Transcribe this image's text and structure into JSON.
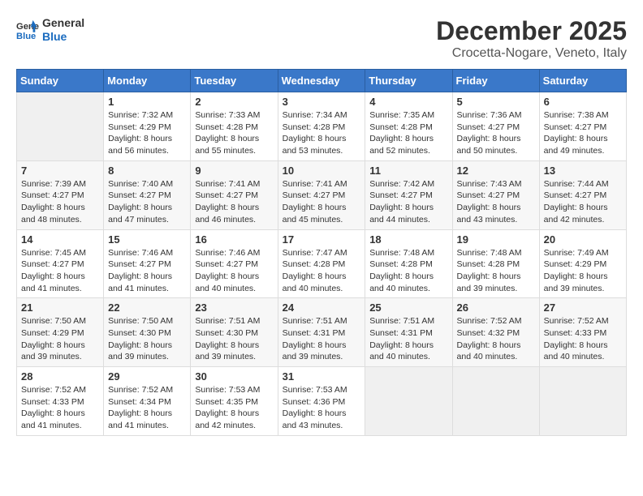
{
  "header": {
    "logo_line1": "General",
    "logo_line2": "Blue",
    "month": "December 2025",
    "location": "Crocetta-Nogare, Veneto, Italy"
  },
  "days_of_week": [
    "Sunday",
    "Monday",
    "Tuesday",
    "Wednesday",
    "Thursday",
    "Friday",
    "Saturday"
  ],
  "weeks": [
    [
      {
        "num": "",
        "info": ""
      },
      {
        "num": "1",
        "info": "Sunrise: 7:32 AM\nSunset: 4:29 PM\nDaylight: 8 hours\nand 56 minutes."
      },
      {
        "num": "2",
        "info": "Sunrise: 7:33 AM\nSunset: 4:28 PM\nDaylight: 8 hours\nand 55 minutes."
      },
      {
        "num": "3",
        "info": "Sunrise: 7:34 AM\nSunset: 4:28 PM\nDaylight: 8 hours\nand 53 minutes."
      },
      {
        "num": "4",
        "info": "Sunrise: 7:35 AM\nSunset: 4:28 PM\nDaylight: 8 hours\nand 52 minutes."
      },
      {
        "num": "5",
        "info": "Sunrise: 7:36 AM\nSunset: 4:27 PM\nDaylight: 8 hours\nand 50 minutes."
      },
      {
        "num": "6",
        "info": "Sunrise: 7:38 AM\nSunset: 4:27 PM\nDaylight: 8 hours\nand 49 minutes."
      }
    ],
    [
      {
        "num": "7",
        "info": "Sunrise: 7:39 AM\nSunset: 4:27 PM\nDaylight: 8 hours\nand 48 minutes."
      },
      {
        "num": "8",
        "info": "Sunrise: 7:40 AM\nSunset: 4:27 PM\nDaylight: 8 hours\nand 47 minutes."
      },
      {
        "num": "9",
        "info": "Sunrise: 7:41 AM\nSunset: 4:27 PM\nDaylight: 8 hours\nand 46 minutes."
      },
      {
        "num": "10",
        "info": "Sunrise: 7:41 AM\nSunset: 4:27 PM\nDaylight: 8 hours\nand 45 minutes."
      },
      {
        "num": "11",
        "info": "Sunrise: 7:42 AM\nSunset: 4:27 PM\nDaylight: 8 hours\nand 44 minutes."
      },
      {
        "num": "12",
        "info": "Sunrise: 7:43 AM\nSunset: 4:27 PM\nDaylight: 8 hours\nand 43 minutes."
      },
      {
        "num": "13",
        "info": "Sunrise: 7:44 AM\nSunset: 4:27 PM\nDaylight: 8 hours\nand 42 minutes."
      }
    ],
    [
      {
        "num": "14",
        "info": "Sunrise: 7:45 AM\nSunset: 4:27 PM\nDaylight: 8 hours\nand 41 minutes."
      },
      {
        "num": "15",
        "info": "Sunrise: 7:46 AM\nSunset: 4:27 PM\nDaylight: 8 hours\nand 41 minutes."
      },
      {
        "num": "16",
        "info": "Sunrise: 7:46 AM\nSunset: 4:27 PM\nDaylight: 8 hours\nand 40 minutes."
      },
      {
        "num": "17",
        "info": "Sunrise: 7:47 AM\nSunset: 4:28 PM\nDaylight: 8 hours\nand 40 minutes."
      },
      {
        "num": "18",
        "info": "Sunrise: 7:48 AM\nSunset: 4:28 PM\nDaylight: 8 hours\nand 40 minutes."
      },
      {
        "num": "19",
        "info": "Sunrise: 7:48 AM\nSunset: 4:28 PM\nDaylight: 8 hours\nand 39 minutes."
      },
      {
        "num": "20",
        "info": "Sunrise: 7:49 AM\nSunset: 4:29 PM\nDaylight: 8 hours\nand 39 minutes."
      }
    ],
    [
      {
        "num": "21",
        "info": "Sunrise: 7:50 AM\nSunset: 4:29 PM\nDaylight: 8 hours\nand 39 minutes."
      },
      {
        "num": "22",
        "info": "Sunrise: 7:50 AM\nSunset: 4:30 PM\nDaylight: 8 hours\nand 39 minutes."
      },
      {
        "num": "23",
        "info": "Sunrise: 7:51 AM\nSunset: 4:30 PM\nDaylight: 8 hours\nand 39 minutes."
      },
      {
        "num": "24",
        "info": "Sunrise: 7:51 AM\nSunset: 4:31 PM\nDaylight: 8 hours\nand 39 minutes."
      },
      {
        "num": "25",
        "info": "Sunrise: 7:51 AM\nSunset: 4:31 PM\nDaylight: 8 hours\nand 40 minutes."
      },
      {
        "num": "26",
        "info": "Sunrise: 7:52 AM\nSunset: 4:32 PM\nDaylight: 8 hours\nand 40 minutes."
      },
      {
        "num": "27",
        "info": "Sunrise: 7:52 AM\nSunset: 4:33 PM\nDaylight: 8 hours\nand 40 minutes."
      }
    ],
    [
      {
        "num": "28",
        "info": "Sunrise: 7:52 AM\nSunset: 4:33 PM\nDaylight: 8 hours\nand 41 minutes."
      },
      {
        "num": "29",
        "info": "Sunrise: 7:52 AM\nSunset: 4:34 PM\nDaylight: 8 hours\nand 41 minutes."
      },
      {
        "num": "30",
        "info": "Sunrise: 7:53 AM\nSunset: 4:35 PM\nDaylight: 8 hours\nand 42 minutes."
      },
      {
        "num": "31",
        "info": "Sunrise: 7:53 AM\nSunset: 4:36 PM\nDaylight: 8 hours\nand 43 minutes."
      },
      {
        "num": "",
        "info": ""
      },
      {
        "num": "",
        "info": ""
      },
      {
        "num": "",
        "info": ""
      }
    ]
  ]
}
